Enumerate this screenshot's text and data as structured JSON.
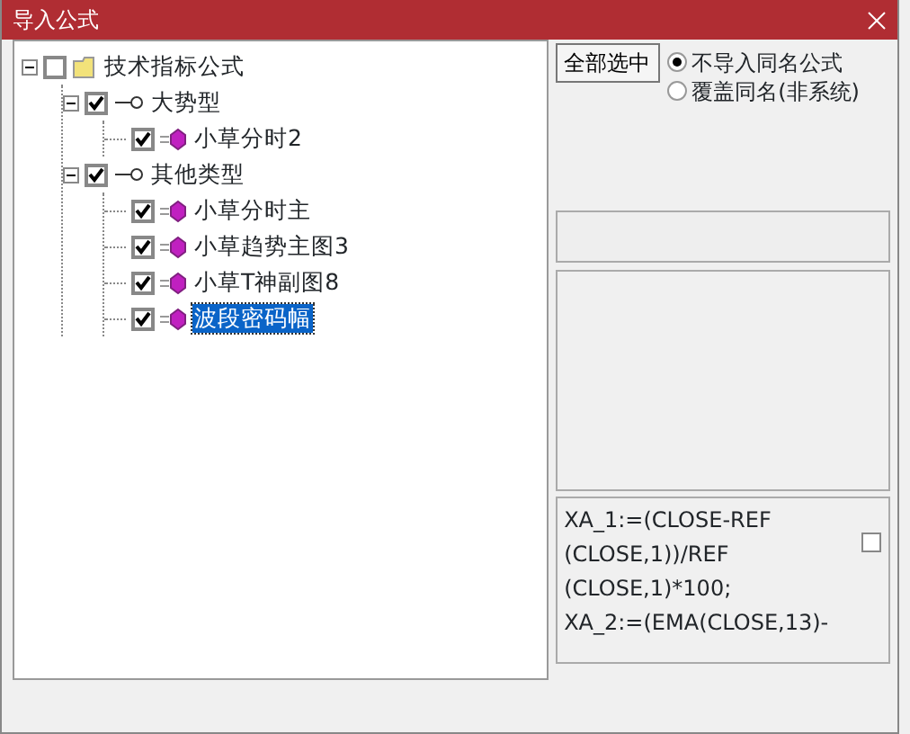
{
  "window": {
    "title": "导入公式"
  },
  "tree": [
    {
      "label": "技术指标公式",
      "kind": "folder",
      "checked": false,
      "expanded": true,
      "selected": false,
      "children": [
        {
          "label": "大势型",
          "kind": "group",
          "checked": true,
          "expanded": true,
          "selected": false,
          "children": [
            {
              "label": "小草分时2",
              "kind": "formula",
              "checked": true,
              "selected": false
            }
          ]
        },
        {
          "label": "其他类型",
          "kind": "group",
          "checked": true,
          "expanded": true,
          "selected": false,
          "children": [
            {
              "label": "小草分时主",
              "kind": "formula",
              "checked": true,
              "selected": false
            },
            {
              "label": "小草趋势主图3",
              "kind": "formula",
              "checked": true,
              "selected": false
            },
            {
              "label": "小草T神副图8",
              "kind": "formula",
              "checked": true,
              "selected": false
            },
            {
              "label": "波段密码幅",
              "kind": "formula",
              "checked": true,
              "selected": true
            }
          ]
        }
      ]
    }
  ],
  "select_all_button": "全部选中",
  "radios": [
    {
      "label": "不导入同名公式",
      "selected": true
    },
    {
      "label": "覆盖同名(非系统)",
      "selected": false
    }
  ],
  "code": {
    "lines": [
      "XA_1:=(CLOSE-REF",
      "(CLOSE,1))/REF",
      "(CLOSE,1)*100;",
      "XA_2:=(EMA(CLOSE,13)-"
    ],
    "checked": false
  }
}
